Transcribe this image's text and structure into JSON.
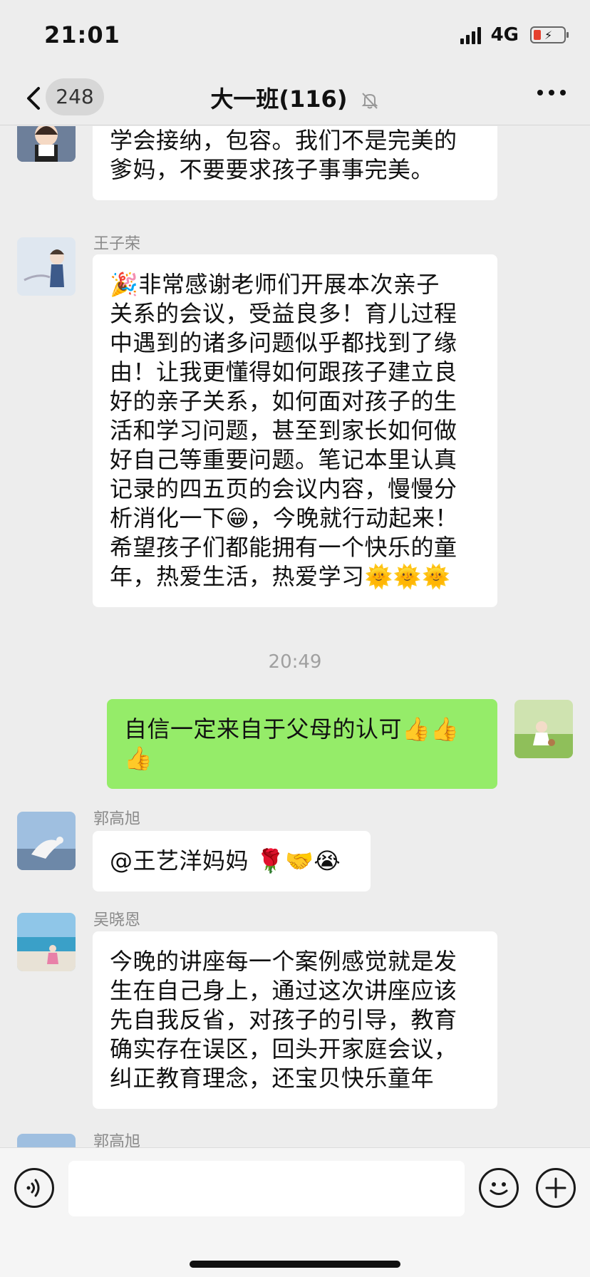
{
  "status_bar": {
    "time": "21:01",
    "network": "4G"
  },
  "nav": {
    "badge_count": "248",
    "title": "大一班(116)"
  },
  "messages": [
    {
      "sender": "",
      "text": "学会接纳，包容。我们不是完美的\n爹妈，不要要求孩子事事完美。"
    },
    {
      "sender": "王子荣",
      "text": "🎉非常感谢老师们开展本次亲子\n关系的会议，受益良多！育儿过程\n中遇到的诸多问题似乎都找到了缘\n由！让我更懂得如何跟孩子建立良\n好的亲子关系，如何面对孩子的生\n活和学习问题，甚至到家长如何做\n好自己等重要问题。笔记本里认真\n记录的四五页的会议内容，慢慢分\n析消化一下😁，今晚就行动起来！\n希望孩子们都能拥有一个快乐的童\n年，热爱生活，热爱学习🌞🌞🌞"
    },
    {
      "time_separator": "20:49"
    },
    {
      "sender": "me",
      "text": "自信一定来自于父母的认可👍👍\n👍"
    },
    {
      "sender": "郭高旭",
      "text": "@王艺洋妈妈 🌹🤝😭"
    },
    {
      "sender": "吴晓恩",
      "text": "今晚的讲座每一个案例感觉就是发\n生在自己身上，通过这次讲座应该\n先自我反省，对孩子的引导，教育\n确实存在误区，回头开家庭会议，\n纠正教育理念，还宝贝快乐童年"
    },
    {
      "sender": "郭高旭",
      "text": ""
    }
  ],
  "colors": {
    "background": "#ededed",
    "my_bubble": "#95ec69",
    "other_bubble": "#ffffff"
  },
  "icons": [
    "back-icon",
    "mute-icon",
    "more-icon",
    "voice-icon",
    "emoji-icon",
    "plus-icon"
  ]
}
